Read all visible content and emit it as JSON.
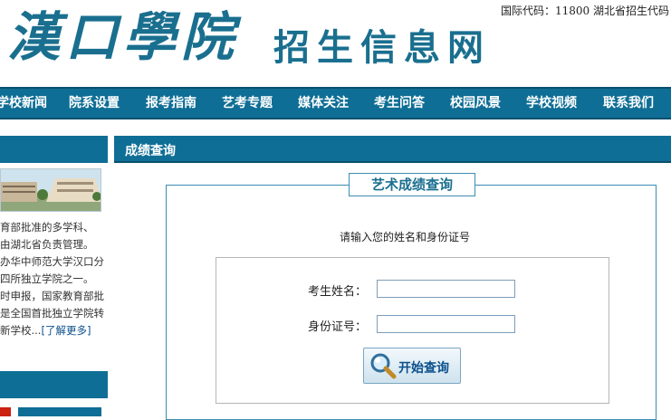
{
  "header": {
    "school_name": "漢口學院",
    "site_name": "招生信息网",
    "code_note": "国际代码：11800  湖北省招生代码"
  },
  "nav": {
    "items": [
      {
        "label": "学校新闻"
      },
      {
        "label": "院系设置"
      },
      {
        "label": "报考指南"
      },
      {
        "label": "艺考专题"
      },
      {
        "label": "媒体关注"
      },
      {
        "label": "考生问答"
      },
      {
        "label": "校园风景"
      },
      {
        "label": "学校视频"
      },
      {
        "label": "联系我们"
      }
    ]
  },
  "sidebar": {
    "intro_lines": [
      "育部批准的多学科、",
      "  由湖北省负责管理。",
      "办华中师范大学汉口分",
      "四所独立学院之一。",
      "时申报，国家教育部批",
      "是全国首批独立学院转",
      "新学校..."
    ],
    "more_link": "[了解更多]"
  },
  "main": {
    "section_title": "成绩查询",
    "panel_title": "艺术成绩查询",
    "hint": "请输入您的姓名和身份证号",
    "form": {
      "name_label": "考生姓名：",
      "id_label": "身份证号：",
      "name_value": "",
      "id_value": "",
      "submit_label": "开始查询"
    }
  },
  "colors": {
    "brand": "#0f6e95",
    "accent": "#1a6f8f"
  }
}
